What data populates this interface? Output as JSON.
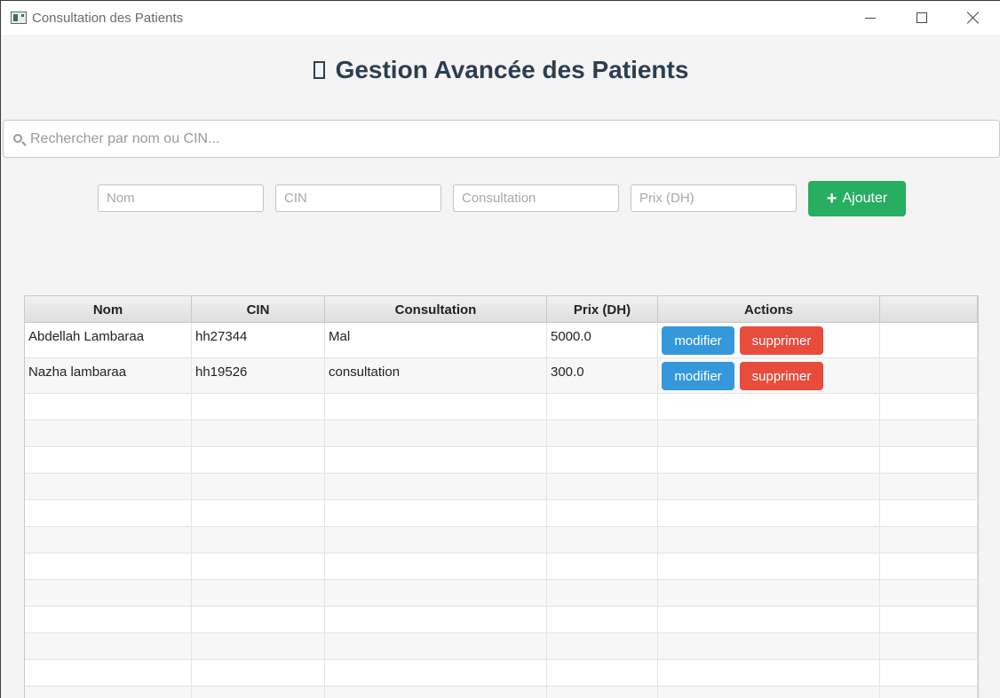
{
  "window": {
    "title": "Consultation des Patients"
  },
  "header": {
    "title": "Gestion Avancée des Patients"
  },
  "search": {
    "placeholder": "Rechercher par nom ou CIN..."
  },
  "form": {
    "nom_placeholder": "Nom",
    "cin_placeholder": "CIN",
    "consultation_placeholder": "Consultation",
    "prix_placeholder": "Prix (DH)",
    "add_label": "Ajouter",
    "add_color": "#27ae60"
  },
  "table": {
    "columns": [
      "Nom",
      "CIN",
      "Consultation",
      "Prix (DH)",
      "Actions",
      ""
    ],
    "rows": [
      {
        "nom": "Abdellah Lambaraa",
        "cin": "hh27344",
        "consultation": "Mal",
        "prix": "5000.0",
        "edit_label": "modifier",
        "delete_label": "supprimer"
      },
      {
        "nom": "Nazha lambaraa",
        "cin": "hh19526",
        "consultation": "consultation",
        "prix": "300.0",
        "edit_label": "modifier",
        "delete_label": "supprimer"
      }
    ],
    "edit_color": "#3498db",
    "delete_color": "#e74c3c"
  }
}
